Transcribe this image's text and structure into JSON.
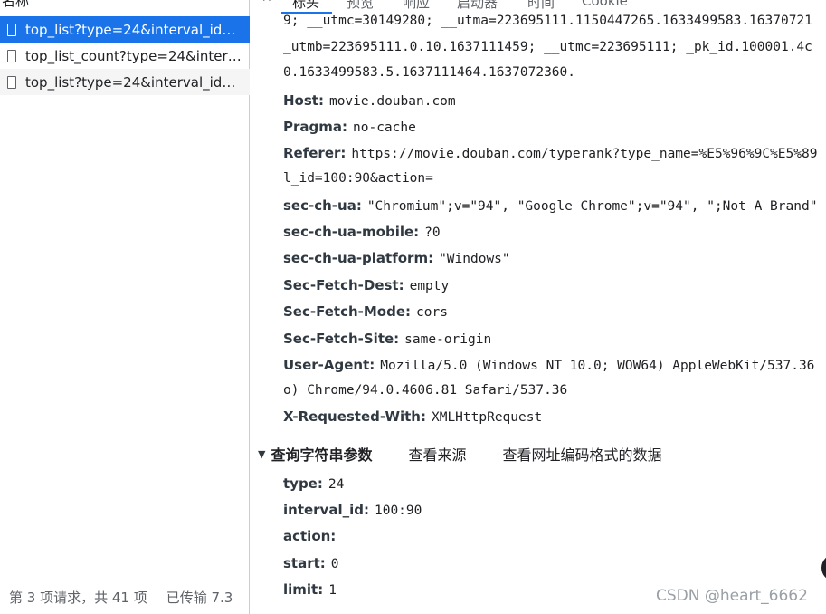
{
  "requests": {
    "header": "名称",
    "items": [
      {
        "label": "top_list?type=24&interval_id=..."
      },
      {
        "label": "top_list_count?type=24&interv..."
      },
      {
        "label": "top_list?type=24&interval_id=..."
      }
    ]
  },
  "status_bar": {
    "requests": "第 3 项请求，共 41 项",
    "transferred": "已传输 7.3"
  },
  "tabs": [
    "标头",
    "预览",
    "响应",
    "启动器",
    "时间",
    "Cookie"
  ],
  "headers": {
    "cookie_continuation": [
      "9; __utmc=30149280; __utma=223695111.1150447265.1633499583.16370721",
      "_utmb=223695111.0.10.1637111459; __utmc=223695111; _pk_id.100001.4c",
      "0.1633499583.5.1637111464.1637072360."
    ],
    "host_key": "Host:",
    "host_val": "movie.douban.com",
    "pragma_key": "Pragma:",
    "pragma_val": "no-cache",
    "referer_key": "Referer:",
    "referer_val": "https://movie.douban.com/typerank?type_name=%E5%96%9C%E5%89",
    "referer_cont": "l_id=100:90&action=",
    "ua_key": "sec-ch-ua:",
    "ua_val": "\"Chromium\";v=\"94\", \"Google Chrome\";v=\"94\", \";Not A Brand\"",
    "mobile_key": "sec-ch-ua-mobile:",
    "mobile_val": "?0",
    "platform_key": "sec-ch-ua-platform:",
    "platform_val": "\"Windows\"",
    "dest_key": "Sec-Fetch-Dest:",
    "dest_val": "empty",
    "mode_key": "Sec-Fetch-Mode:",
    "mode_val": "cors",
    "site_key": "Sec-Fetch-Site:",
    "site_val": "same-origin",
    "useragent_key": "User-Agent:",
    "useragent_val": "Mozilla/5.0 (Windows NT 10.0; WOW64) AppleWebKit/537.36",
    "useragent_cont": "o) Chrome/94.0.4606.81 Safari/537.36",
    "xrw_key": "X-Requested-With:",
    "xrw_val": "XMLHttpRequest"
  },
  "query_section": {
    "title": "查询字符串参数",
    "view_source": "查看来源",
    "view_url_encoded": "查看网址编码格式的数据",
    "params": [
      {
        "key": "type:",
        "val": "24"
      },
      {
        "key": "interval_id:",
        "val": "100:90"
      },
      {
        "key": "action:",
        "val": ""
      },
      {
        "key": "start:",
        "val": "0"
      },
      {
        "key": "limit:",
        "val": "1"
      }
    ]
  },
  "watermark": "CSDN @heart_6662"
}
